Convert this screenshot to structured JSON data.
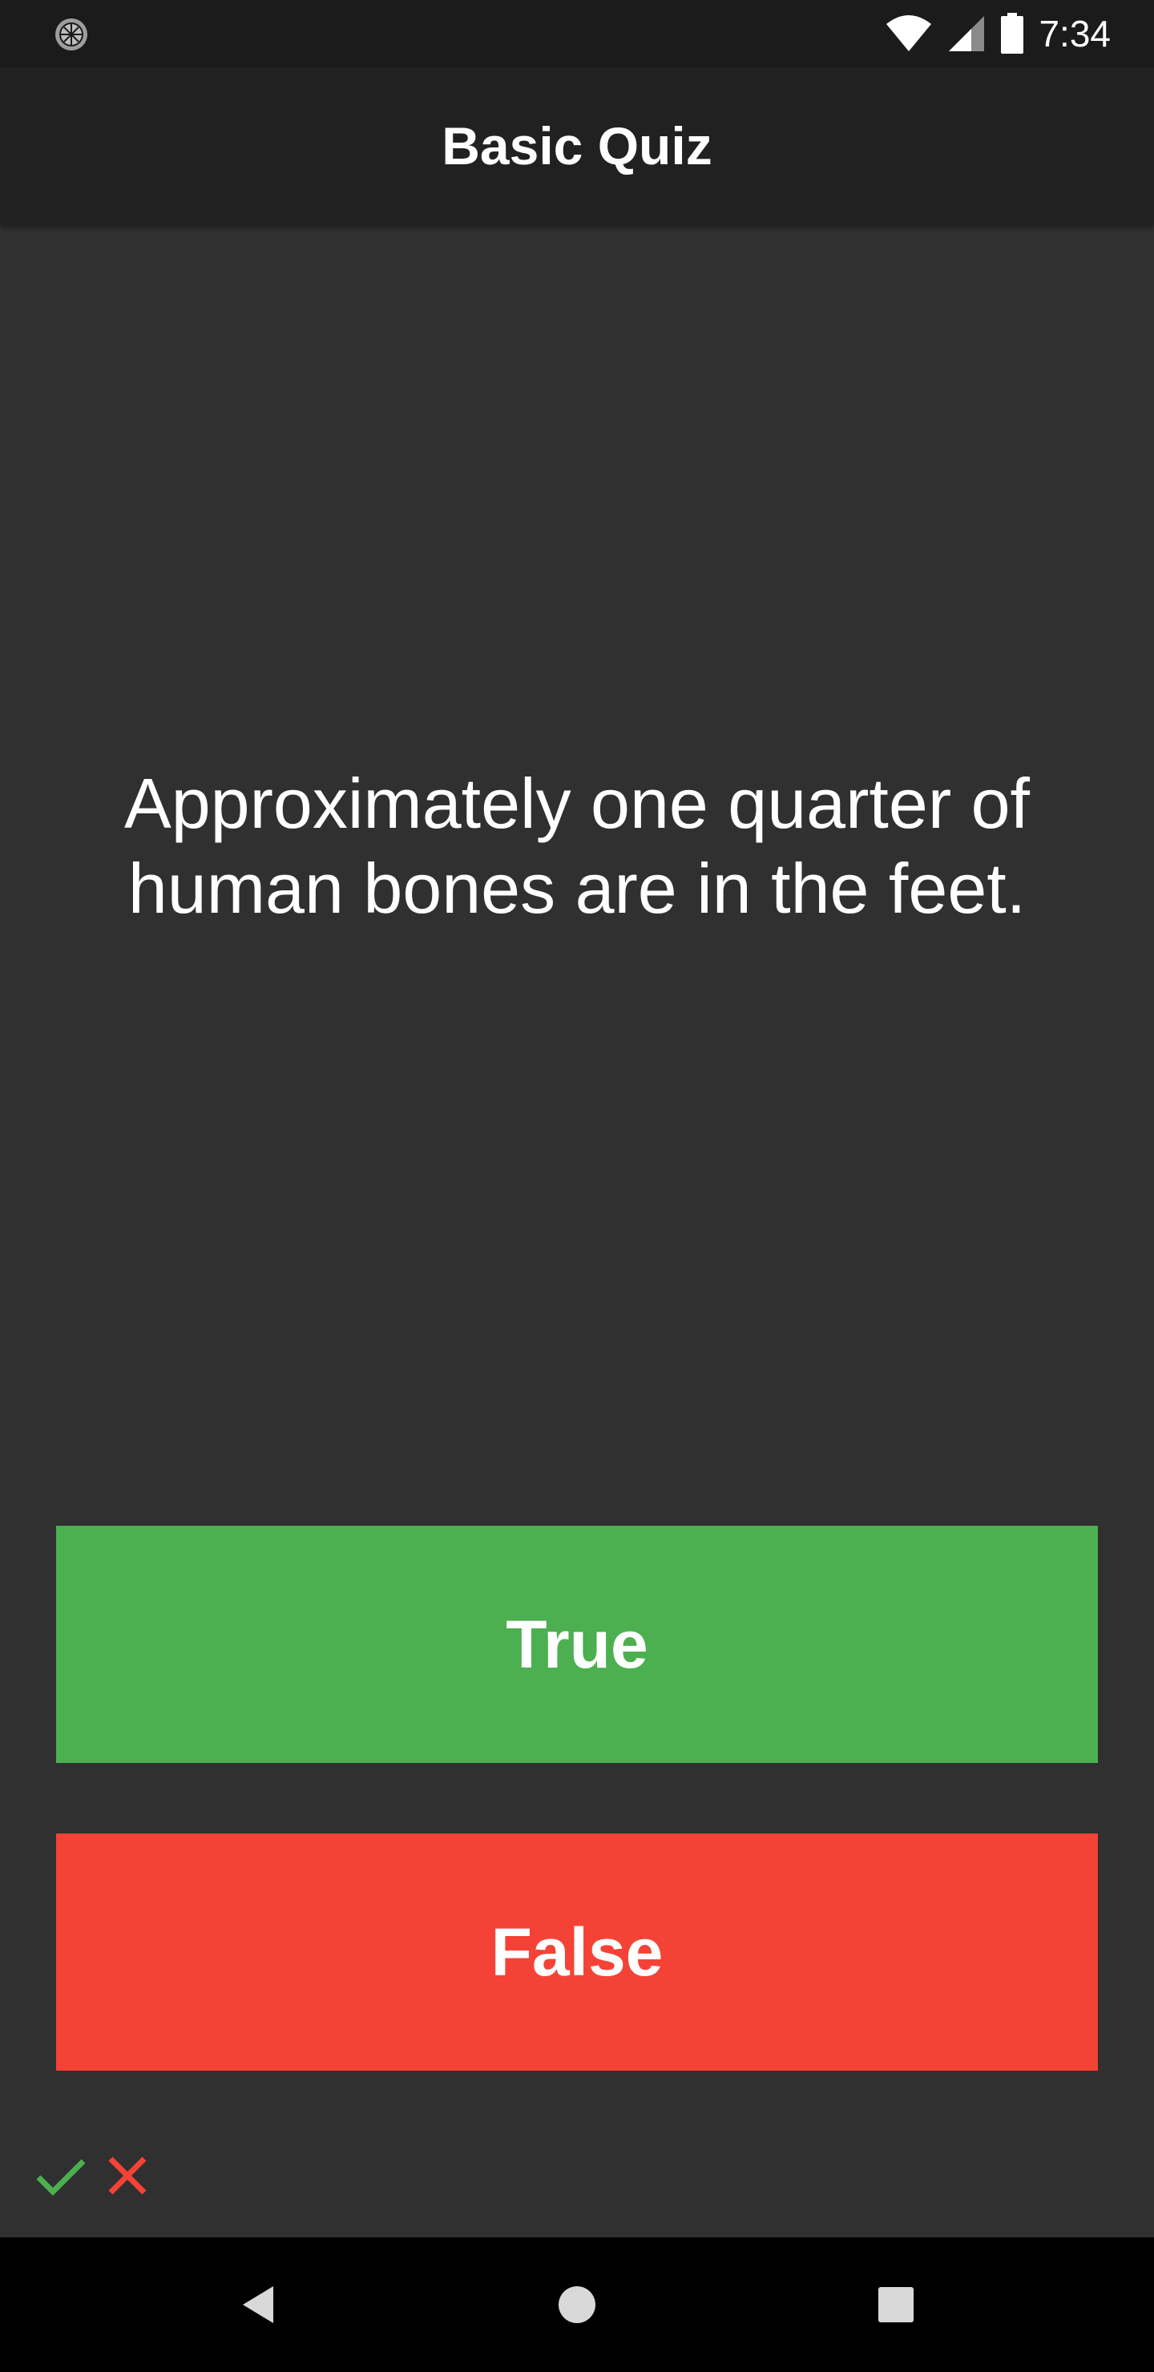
{
  "status_bar": {
    "time": "7:34",
    "icons": [
      "sync-icon",
      "wifi-icon",
      "signal-icon",
      "battery-icon"
    ]
  },
  "app_bar": {
    "title": "Basic Quiz"
  },
  "question": {
    "line1": "Approximately one quarter of",
    "line2": "human bones are in the feet."
  },
  "answers": {
    "true_label": "True",
    "false_label": "False"
  },
  "score": {
    "icons": [
      "check-icon",
      "cross-icon"
    ]
  },
  "nav_bar": {
    "icons": [
      "back-icon",
      "home-icon",
      "recents-icon"
    ]
  },
  "colors": {
    "background": "#303030",
    "app_bar": "#212121",
    "status_bar": "#1b1b1b",
    "true": "#4caf50",
    "false": "#f44336",
    "nav_bar": "#000000"
  }
}
